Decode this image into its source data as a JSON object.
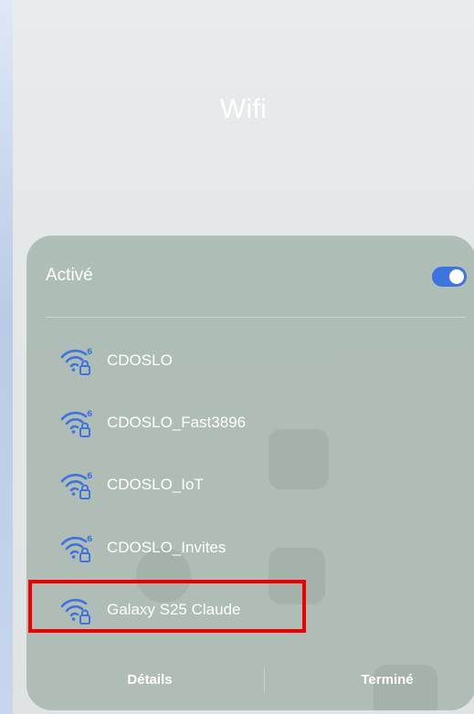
{
  "title": "Wifi",
  "panel": {
    "status_label": "Activé",
    "wifi_enabled": true,
    "networks": [
      {
        "name": "CDOSLO",
        "icon": "wifi-6-locked-icon"
      },
      {
        "name": "CDOSLO_Fast3896",
        "icon": "wifi-6-locked-icon"
      },
      {
        "name": "CDOSLO_IoT",
        "icon": "wifi-6-locked-icon"
      },
      {
        "name": "CDOSLO_Invites",
        "icon": "wifi-6-locked-icon"
      },
      {
        "name": "Galaxy S25 Claude",
        "icon": "wifi-locked-icon"
      }
    ],
    "details_label": "Détails",
    "done_label": "Terminé"
  },
  "colors": {
    "accent": "#3f73de",
    "highlight": "#ee0000",
    "panel": "#aabab2"
  }
}
